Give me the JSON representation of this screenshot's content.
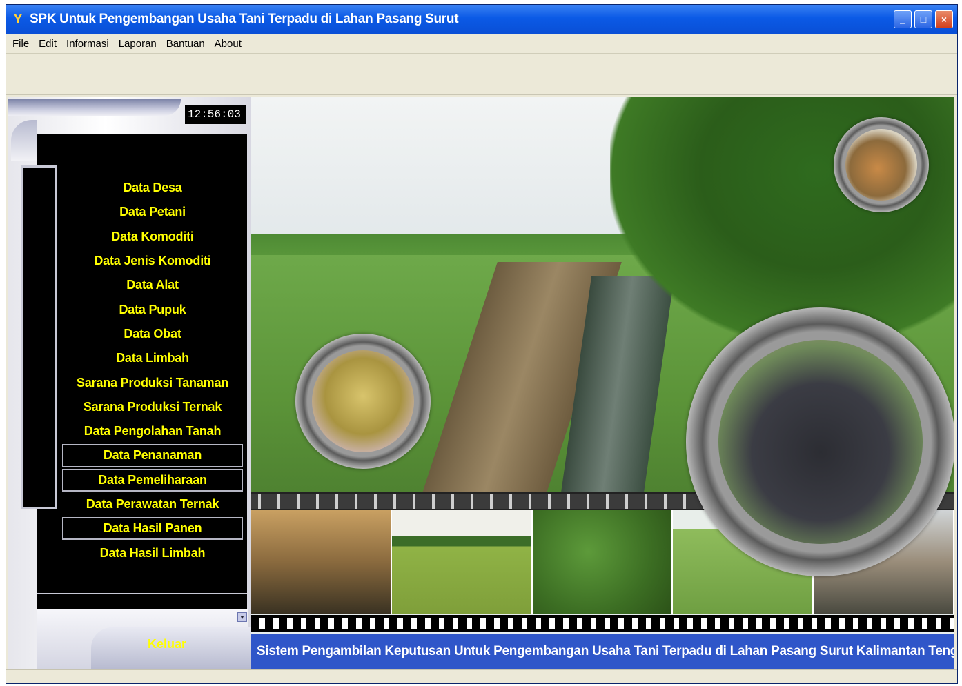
{
  "window": {
    "title": "SPK Untuk Pengembangan Usaha Tani Terpadu di Lahan Pasang Surut",
    "app_icon_glyph": "Y",
    "controls": {
      "minimize": "_",
      "maximize": "□",
      "close": "×"
    }
  },
  "menu": {
    "items": [
      "File",
      "Edit",
      "Informasi",
      "Laporan",
      "Bantuan",
      "About"
    ]
  },
  "clock": {
    "time": "12:56:03"
  },
  "nav": {
    "items": [
      {
        "label": "Data Desa",
        "boxed": false
      },
      {
        "label": "Data Petani",
        "boxed": false
      },
      {
        "label": "Data Komoditi",
        "boxed": false
      },
      {
        "label": "Data Jenis Komoditi",
        "boxed": false
      },
      {
        "label": "Data Alat",
        "boxed": false
      },
      {
        "label": "Data Pupuk",
        "boxed": false
      },
      {
        "label": "Data Obat",
        "boxed": false
      },
      {
        "label": "Data Limbah",
        "boxed": false
      },
      {
        "label": "Sarana Produksi Tanaman",
        "boxed": false
      },
      {
        "label": "Sarana Produksi Ternak",
        "boxed": false
      },
      {
        "label": "Data Pengolahan Tanah",
        "boxed": false
      },
      {
        "label": "Data Penanaman",
        "boxed": true
      },
      {
        "label": "Data Pemeliharaan",
        "boxed": true
      },
      {
        "label": "Data Perawatan Ternak",
        "boxed": false
      },
      {
        "label": "Data Hasil Panen",
        "boxed": true
      },
      {
        "label": "Data Hasil Limbah",
        "boxed": false
      }
    ]
  },
  "exit": {
    "label": "Keluar"
  },
  "status": {
    "text": "Sistem Pengambilan Keputusan Untuk Pengembangan Usaha Tani Terpadu di Lahan Pasang Surut Kalimantan Tengah"
  },
  "colors": {
    "title_bar": "#0b5ae6",
    "nav_text": "#ffff00",
    "nav_bg": "#000000",
    "status_bar": "#2f56c9"
  }
}
